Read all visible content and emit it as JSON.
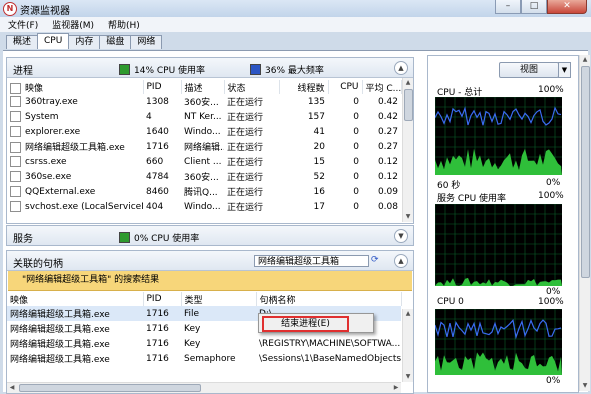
{
  "window": {
    "title": "资源监视器",
    "app_icon": "N",
    "minimize": "–",
    "restore": "□",
    "close": "✕"
  },
  "menu": [
    "文件(F)",
    "监视器(M)",
    "帮助(H)"
  ],
  "tabs": [
    "概述",
    "CPU",
    "内存",
    "磁盘",
    "网络"
  ],
  "active_tab": "CPU",
  "process_pane": {
    "title": "进程",
    "cpu_usage": "14% CPU 使用率",
    "max_freq": "36% 最大频率",
    "usage_color": "#2e9a2e",
    "freq_color": "#2b55c4",
    "columns": [
      "映像",
      "PID",
      "描述",
      "状态",
      "线程数",
      "CPU",
      "平均 C..."
    ],
    "rows": [
      [
        "360tray.exe",
        "1308",
        "360安...",
        "正在运行",
        "135",
        "0",
        "0.42"
      ],
      [
        "System",
        "4",
        "NT Ker...",
        "正在运行",
        "157",
        "0",
        "0.42"
      ],
      [
        "explorer.exe",
        "1640",
        "Windo...",
        "正在运行",
        "41",
        "0",
        "0.27"
      ],
      [
        "网络编辑超级工具箱.exe",
        "1716",
        "网络编辑...",
        "正在运行",
        "20",
        "0",
        "0.27"
      ],
      [
        "csrss.exe",
        "660",
        "Client ...",
        "正在运行",
        "15",
        "0",
        "0.12"
      ],
      [
        "360se.exe",
        "4784",
        "360安...",
        "正在运行",
        "52",
        "0",
        "0.12"
      ],
      [
        "QQExternal.exe",
        "8460",
        "腾讯Q...",
        "正在运行",
        "16",
        "0",
        "0.09"
      ],
      [
        "svchost.exe (LocalServiceN...",
        "404",
        "Windo...",
        "正在运行",
        "17",
        "0",
        "0.08"
      ]
    ]
  },
  "services_pane": {
    "title": "服务",
    "cpu_usage": "0% CPU 使用率"
  },
  "handles_pane": {
    "title": "关联的句柄",
    "search_value": "网络编辑超级工具箱",
    "result_text": "\"网络编辑超级工具箱\" 的搜索结果",
    "columns": [
      "映像",
      "PID",
      "类型",
      "句柄名称"
    ],
    "rows": [
      [
        "网络编辑超级工具箱.exe",
        "1716",
        "File",
        "D:\\..."
      ],
      [
        "网络编辑超级工具箱.exe",
        "1716",
        "Key",
        "\\..."
      ],
      [
        "网络编辑超级工具箱.exe",
        "1716",
        "Key",
        "\\REGISTRY\\MACHINE\\SOFTWA..."
      ],
      [
        "网络编辑超级工具箱.exe",
        "1716",
        "Semaphore",
        "\\Sessions\\1\\BaseNamedObjects..."
      ]
    ]
  },
  "context_menu": {
    "item": "结束进程(E)"
  },
  "right_panel": {
    "view_label": "视图",
    "graphs": [
      {
        "label": "CPU - 总计",
        "top": "100%",
        "bottom_left": "60 秒",
        "bottom_right": "0%",
        "level": 0.75
      },
      {
        "label": "服务 CPU 使用率",
        "top": "100%",
        "bottom_right": "0%",
        "level": 0.08
      },
      {
        "label": "CPU 0",
        "top": "100%",
        "bottom_right": "0%",
        "level": 0.7
      }
    ]
  }
}
